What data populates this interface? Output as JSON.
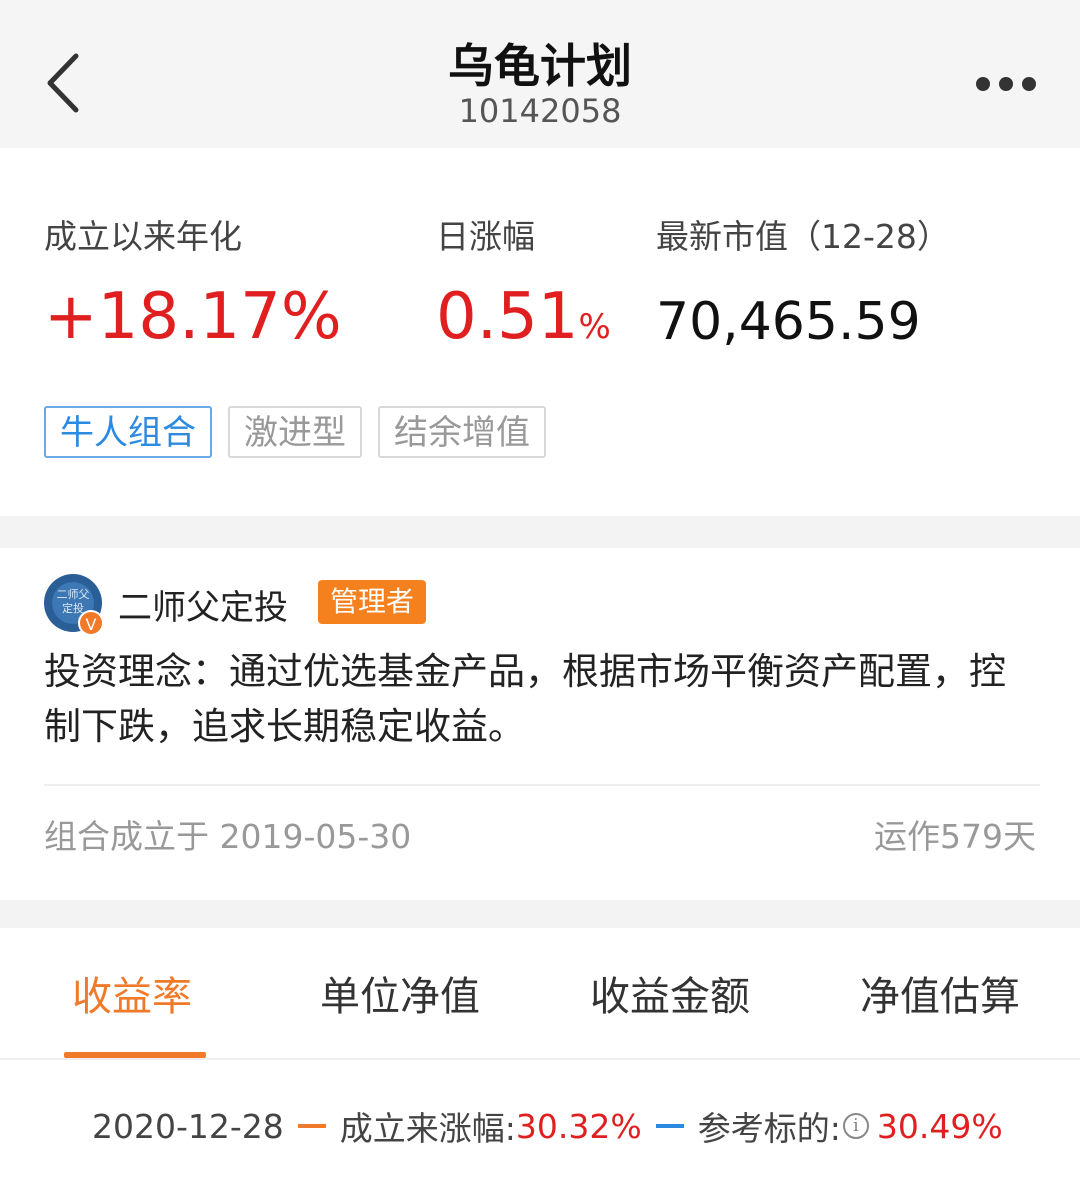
{
  "header": {
    "title": "乌龟计划",
    "code": "10142058"
  },
  "stats": {
    "annualized_label": "成立以来年化",
    "annualized_value": "+18.17%",
    "daily_label": "日涨幅",
    "daily_value": "0.51",
    "daily_unit": "%",
    "market_value_label": "最新市值（12-28）",
    "market_value": "70,465.59"
  },
  "tags": [
    "牛人组合",
    "激进型",
    "结余增值"
  ],
  "manager": {
    "avatar_text": "二师父定投",
    "verified_mark": "V",
    "name": "二师父定投",
    "badge": "管理者",
    "philosophy": "投资理念：通过优选基金产品，根据市场平衡资产配置，控制下跌，追求长期稳定收益。",
    "founded": "组合成立于 2019-05-30",
    "running_days": "运作579天"
  },
  "tabs": [
    {
      "label": "收益率",
      "active": true
    },
    {
      "label": "单位净值",
      "active": false
    },
    {
      "label": "收益金额",
      "active": false
    },
    {
      "label": "净值估算",
      "active": false
    }
  ],
  "legend": {
    "date": "2020-12-28",
    "series1_label": "成立来涨幅:",
    "series1_value": "30.32%",
    "series2_label": "参考标的:",
    "info_glyph": "i",
    "series2_value": "30.49%"
  },
  "colors": {
    "red": "#e02020",
    "orange": "#f07a2a",
    "blue": "#2a8ae0"
  }
}
